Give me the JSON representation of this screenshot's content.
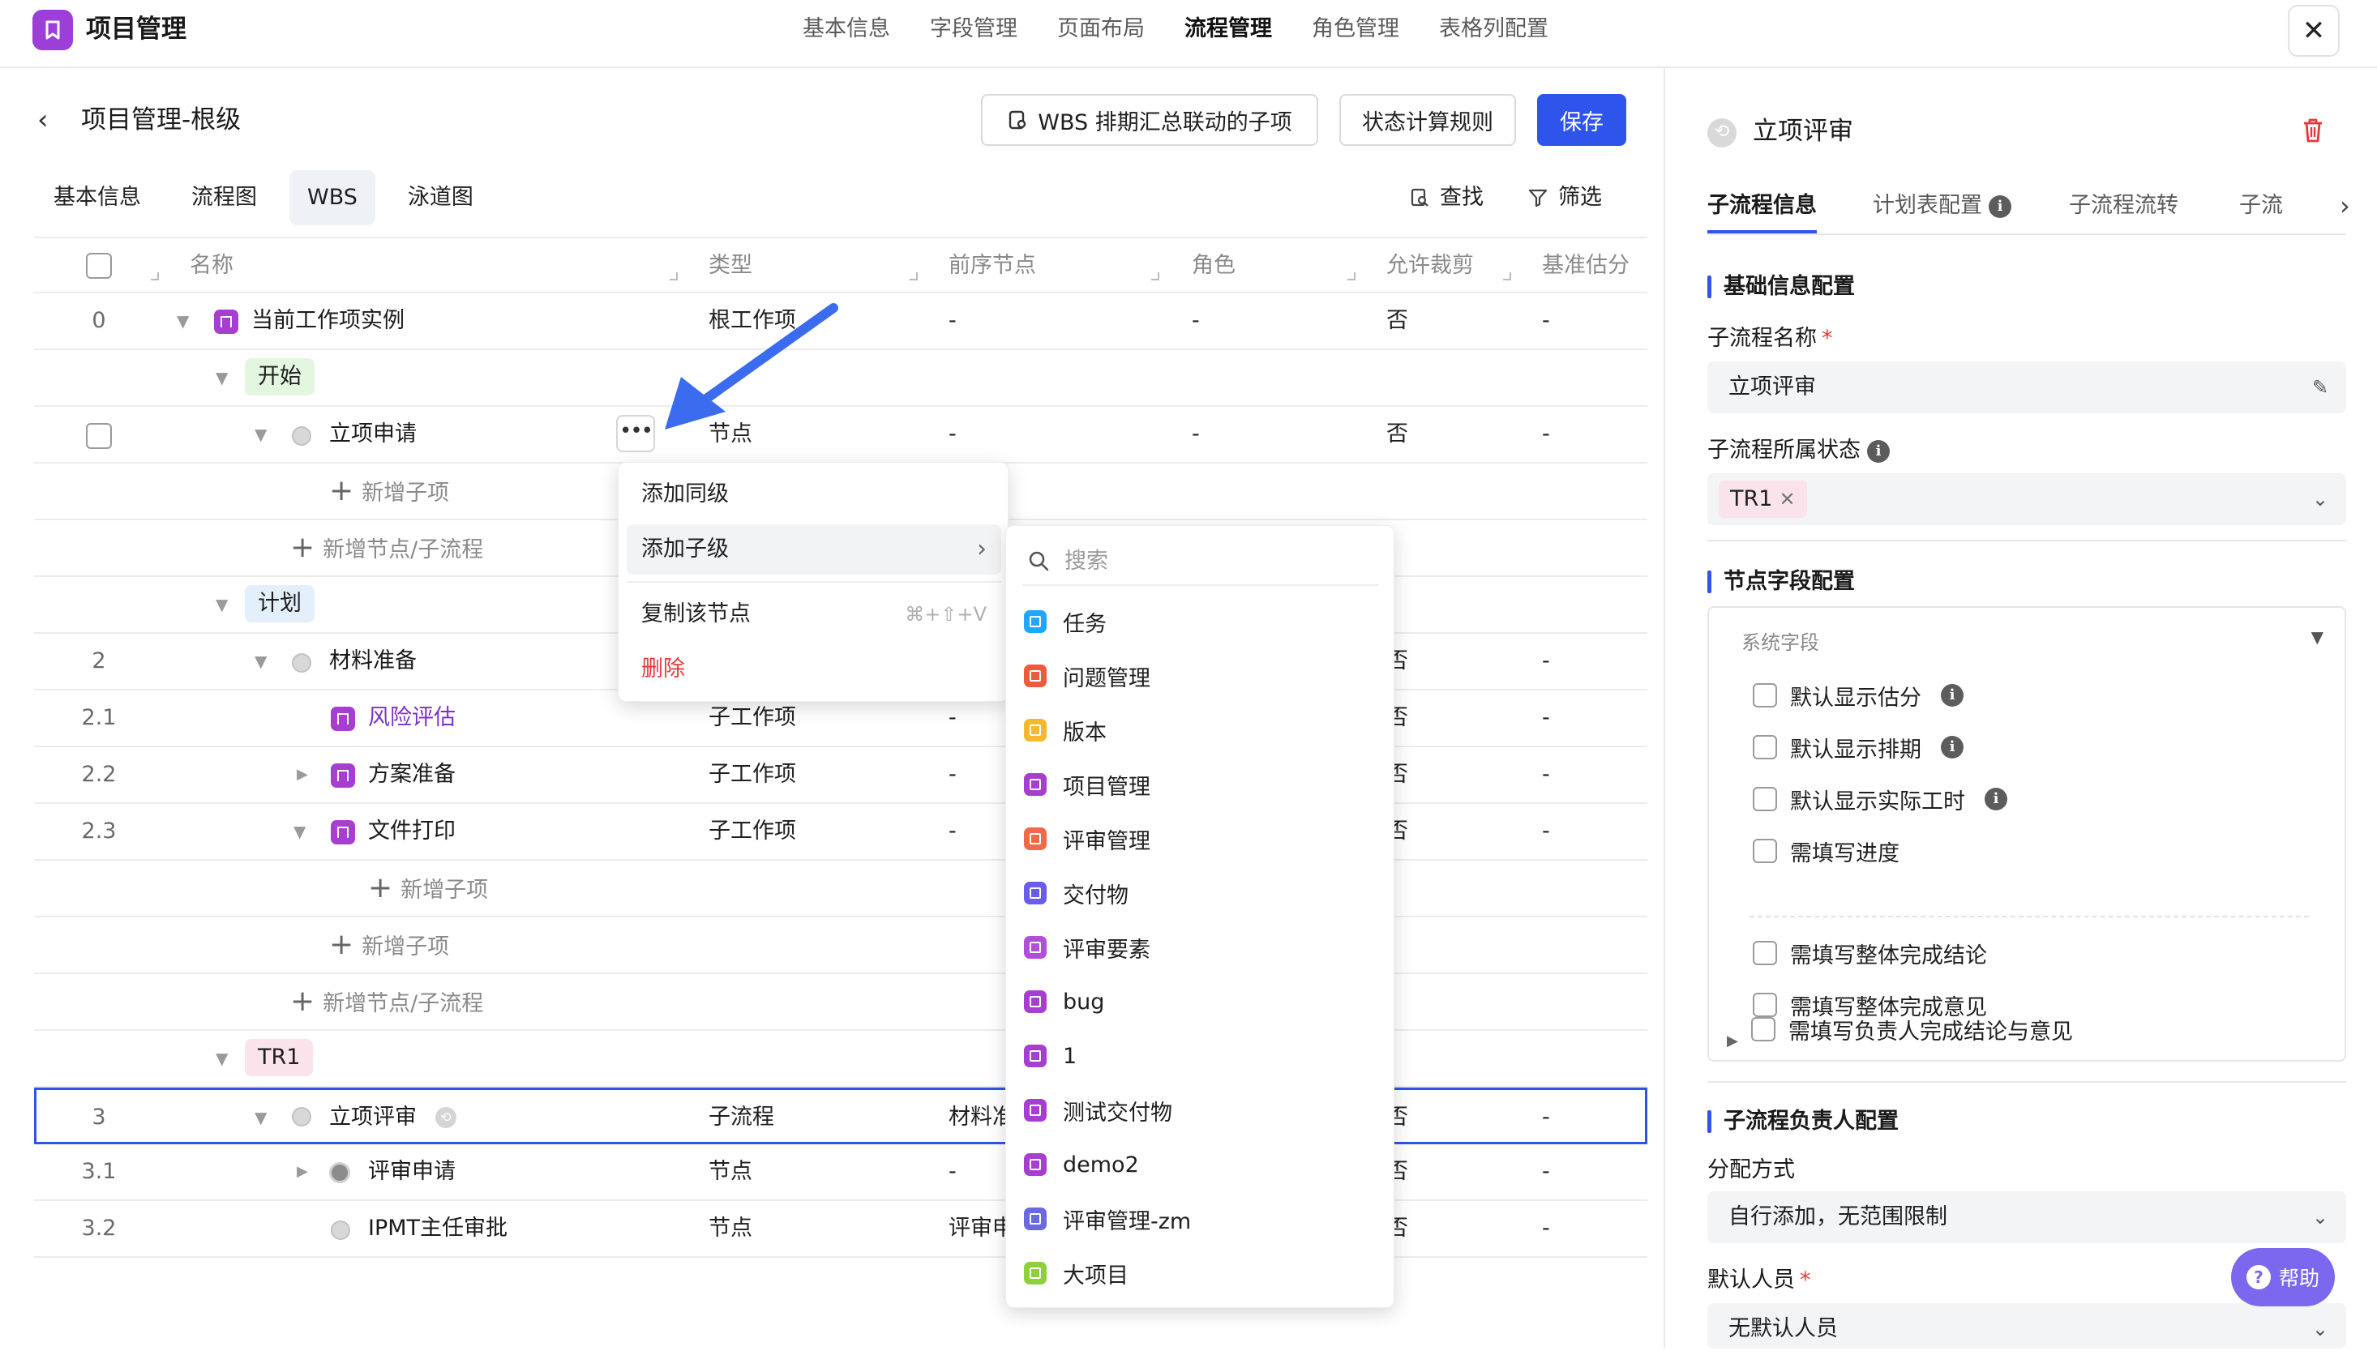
{
  "app": {
    "title": "项目管理"
  },
  "topnav": [
    "基本信息",
    "字段管理",
    "页面布局",
    "流程管理",
    "角色管理",
    "表格列配置"
  ],
  "header": {
    "title": "项目管理-根级",
    "btn_wbs": "WBS 排期汇总联动的子项",
    "btn_rule": "状态计算规则",
    "btn_save": "保存"
  },
  "subtabs": [
    "基本信息",
    "流程图",
    "WBS",
    "泳道图"
  ],
  "tools": {
    "find": "查找",
    "filter": "筛选"
  },
  "table": {
    "columns": [
      "名称",
      "类型",
      "前序节点",
      "角色",
      "允许裁剪",
      "基准估分"
    ],
    "rows": [
      {
        "num": "0",
        "name": "当前工作项实例",
        "type": "根工作项",
        "pre": "-",
        "role": "-",
        "cut": "否",
        "est": "-"
      },
      {
        "stage": "开始"
      },
      {
        "num": "",
        "name": "立项申请",
        "type": "节点",
        "pre": "-",
        "role": "-",
        "cut": "否",
        "est": "-"
      },
      {
        "add": "新增子项"
      },
      {
        "add": "新增节点/子流程"
      },
      {
        "stage": "计划"
      },
      {
        "num": "2",
        "name": "材料准备",
        "type": "",
        "pre": "",
        "role": "",
        "cut": "否",
        "est": "-"
      },
      {
        "num": "2.1",
        "name": "风险评估",
        "type": "子工作项",
        "pre": "-",
        "role": "",
        "cut": "否",
        "est": "-"
      },
      {
        "num": "2.2",
        "name": "方案准备",
        "type": "子工作项",
        "pre": "-",
        "role": "",
        "cut": "否",
        "est": "-"
      },
      {
        "num": "2.3",
        "name": "文件打印",
        "type": "子工作项",
        "pre": "-",
        "role": "",
        "cut": "否",
        "est": "-"
      },
      {
        "add": "新增子项"
      },
      {
        "add": "新增子项"
      },
      {
        "add": "新增节点/子流程"
      },
      {
        "stage": "TR1"
      },
      {
        "num": "3",
        "name": "立项评审",
        "type": "子流程",
        "pre": "材料准",
        "role": "",
        "cut": "否",
        "est": "-"
      },
      {
        "num": "3.1",
        "name": "评审申请",
        "type": "节点",
        "pre": "-",
        "role": "",
        "cut": "否",
        "est": "-"
      },
      {
        "num": "3.2",
        "name": "IPMT主任审批",
        "type": "节点",
        "pre": "评审申",
        "role": "",
        "cut": "否",
        "est": "-"
      }
    ]
  },
  "context_menu": {
    "add_sibling": "添加同级",
    "add_child": "添加子级",
    "copy_node": "复制该节点",
    "copy_shortcut": "⌘+⇧+V",
    "delete": "删除"
  },
  "type_menu": {
    "search_placeholder": "搜索",
    "items": [
      {
        "label": "任务",
        "color": "#1ea7fd"
      },
      {
        "label": "问题管理",
        "color": "#f05a3c"
      },
      {
        "label": "版本",
        "color": "#f5b82e"
      },
      {
        "label": "项目管理",
        "color": "#a63fd0"
      },
      {
        "label": "评审管理",
        "color": "#f06a4a"
      },
      {
        "label": "交付物",
        "color": "#6a5cf0"
      },
      {
        "label": "评审要素",
        "color": "#b04fd8"
      },
      {
        "label": "bug",
        "color": "#a63fd0"
      },
      {
        "label": "1",
        "color": "#a63fd0"
      },
      {
        "label": "测试交付物",
        "color": "#a63fd0"
      },
      {
        "label": "demo2",
        "color": "#a63fd0"
      },
      {
        "label": "评审管理-zm",
        "color": "#6a6ae0"
      },
      {
        "label": "大项目",
        "color": "#8fd13c"
      }
    ]
  },
  "right_panel": {
    "title": "立项评审",
    "tabs": [
      "子流程信息",
      "计划表配置",
      "子流程流转",
      "子流"
    ],
    "section_basic": "基础信息配置",
    "label_name": "子流程名称",
    "value_name": "立项评审",
    "label_state": "子流程所属状态",
    "state_chip": "TR1",
    "section_fields": "节点字段配置",
    "system_fields": "系统字段",
    "checkboxes": [
      "默认显示估分",
      "默认显示排期",
      "默认显示实际工时",
      "需填写进度",
      "需填写整体完成结论",
      "需填写整体完成意见",
      "需填写负责人完成结论与意见"
    ],
    "section_owner": "子流程负责人配置",
    "label_assign": "分配方式",
    "value_assign": "自行添加，无范围限制",
    "label_default": "默认人员",
    "value_default": "无默认人员"
  },
  "help": "帮助",
  "colors": {
    "primary": "#2f54eb",
    "danger": "#e53935",
    "app": "#9b3fd8"
  }
}
